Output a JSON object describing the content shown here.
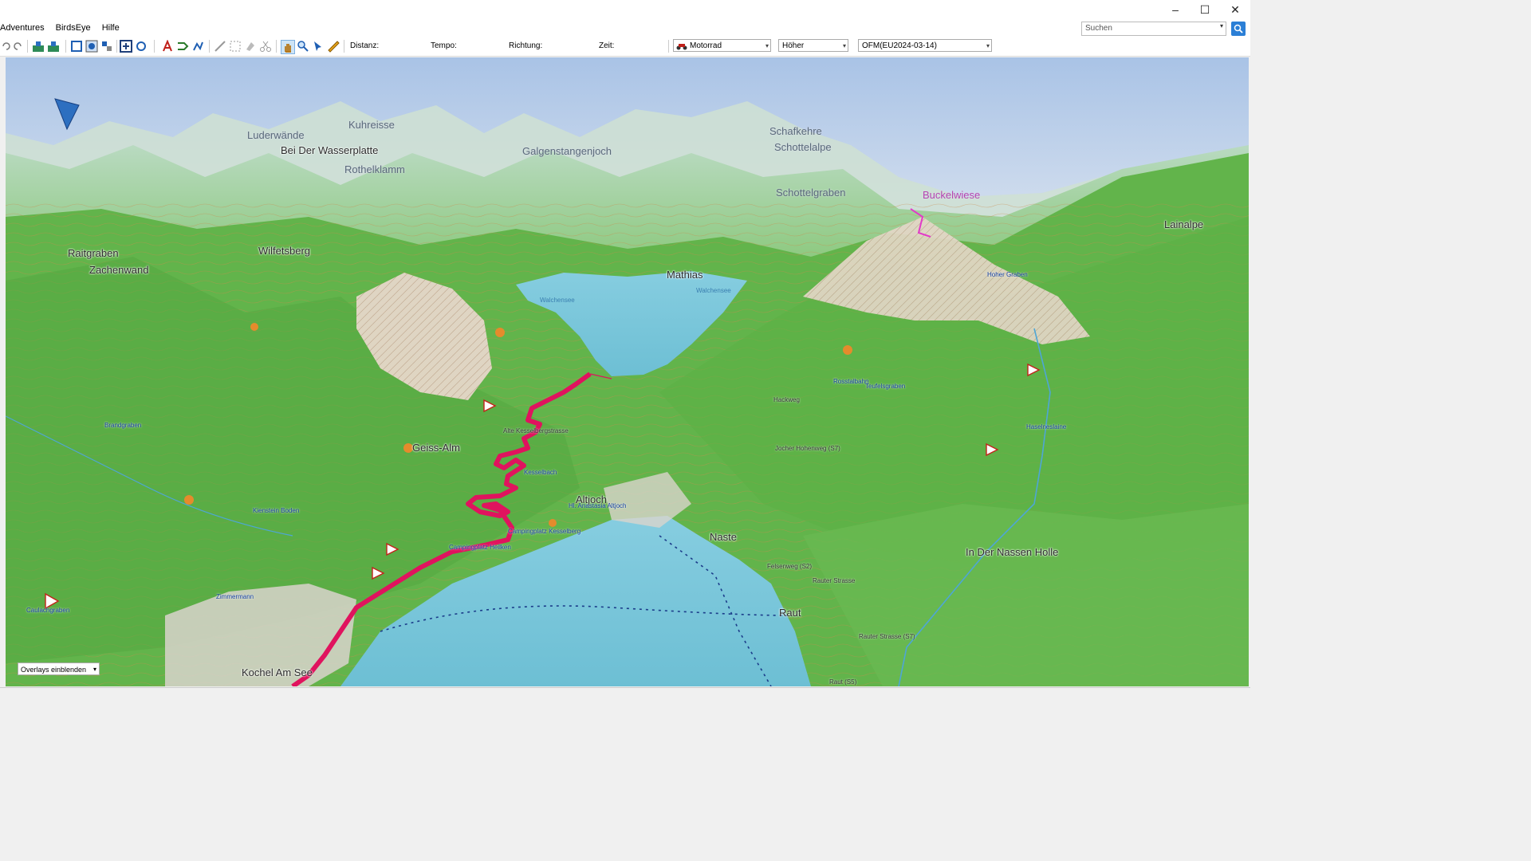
{
  "menu": {
    "items": [
      "Adventures",
      "BirdsEye",
      "Hilfe"
    ]
  },
  "search": {
    "placeholder": "Suchen"
  },
  "window": {
    "minimize": "–",
    "maximize": "☐",
    "close": "✕"
  },
  "toolbar": {
    "distance_label": "Distanz:",
    "speed_label": "Tempo:",
    "direction_label": "Richtung:",
    "time_label": "Zeit:",
    "profile_value": "Motorrad",
    "detail_value": "Höher",
    "map_value": "OFM(EU2024-03-14)"
  },
  "map": {
    "overlay_combo": "Overlays einblenden",
    "labels": {
      "luderwande": "Luderwände",
      "kuhreisse": "Kuhreisse",
      "wasserplatte": "Bei Der Wasserplatte",
      "rothelklamm": "Rothelklamm",
      "galgenstangenjoch": "Galgenstangenjoch",
      "schafkehre": "Schafkehre",
      "schottelalpe": "Schottelalpe",
      "schottelgraben": "Schottelgraben",
      "buckelwiese": "Buckelwiese",
      "lainalpe": "Lainalpe",
      "raitgraben": "Raitgraben",
      "zachenwand": "Zachenwand",
      "wilfetsberg": "Wilfetsberg",
      "mathias": "Mathias",
      "geiss_alm": "Geiss-Alm",
      "altjoch": "Altjoch",
      "nasse": "Naste",
      "in_der_nassen_holle": "In Der Nassen Holle",
      "raut": "Raut",
      "kochel": "Kochel Am See",
      "brandgraben": "Brandgraben",
      "walchensee": "Walchensee",
      "hoher_graben": "Hoher Graben",
      "kesselbergstrasse": "Alte Kesselbergstrasse",
      "kesselbach": "Kesselbach",
      "campingplatz1": "Campingplatz Kesselberg",
      "campingplatz2": "Campingplatz Heilken",
      "zimmermann": "Zimmermann",
      "caulachgraben": "Caulachgraben",
      "rosstalbahn": "Rosstalbahn",
      "teufelsgraben": "Teufelsgraben",
      "hackweg": "Hackweg",
      "hohenweg": "Jocher Hohenweg (S7)",
      "haselneslaine": "Haselneslaine",
      "felsenweg": "Felsenweg (S2)",
      "rauter_strasse": "Rauter Strasse",
      "rauter_strasse2": "Rauter Strasse (S7)",
      "anastasia": "Hl. Anastasia Altjoch",
      "kienstein": "Kienstein Boden",
      "raut_s5": "Raut (S5)"
    },
    "colors": {
      "route": "#e0135e",
      "lake": "#77c2d6",
      "meadow": "#62b44b",
      "rock": "#e2d4c8"
    }
  }
}
